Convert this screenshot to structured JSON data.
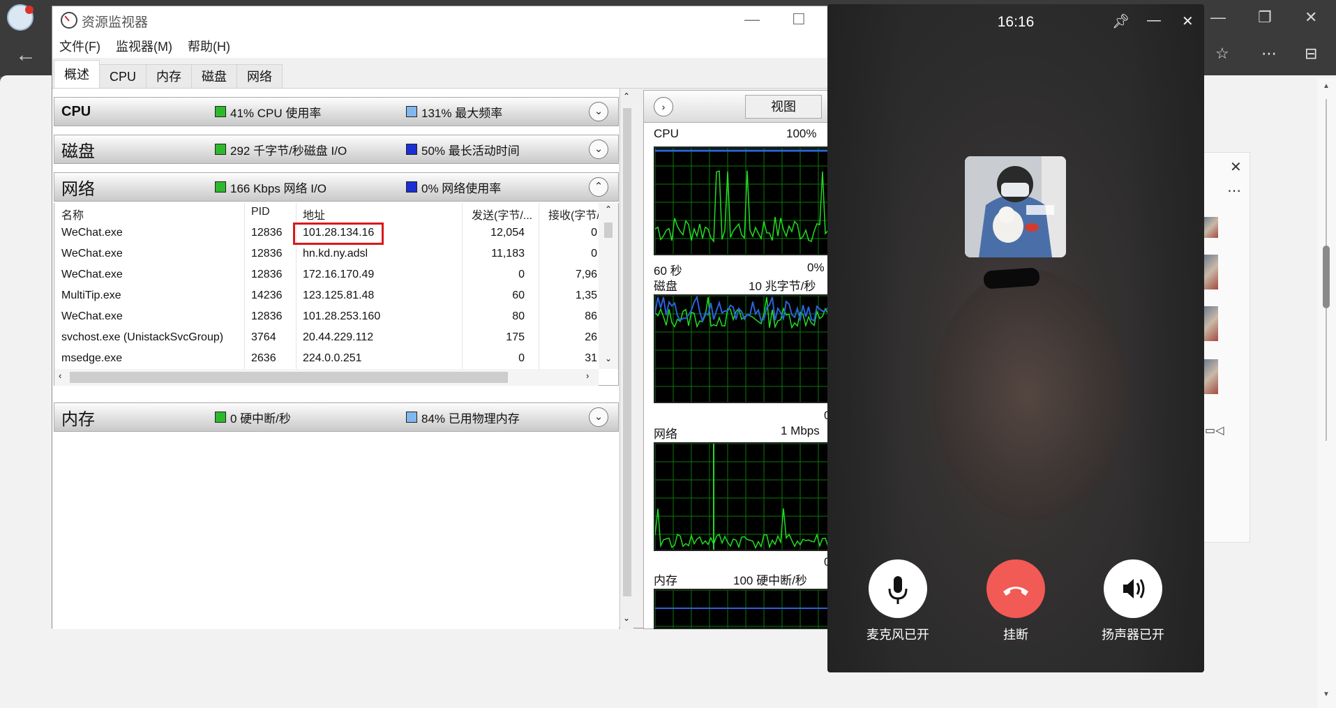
{
  "resmon": {
    "title": "资源监视器",
    "menu": [
      "文件(F)",
      "监视器(M)",
      "帮助(H)"
    ],
    "tabs": [
      "概述",
      "CPU",
      "内存",
      "磁盘",
      "网络"
    ],
    "sections": {
      "cpu": {
        "name": "CPU",
        "metric1": "41% CPU 使用率",
        "metric2": "131% 最大频率"
      },
      "disk": {
        "name": "磁盘",
        "metric1": "292 千字节/秒磁盘 I/O",
        "metric2": "50% 最长活动时间"
      },
      "network": {
        "name": "网络",
        "metric1": "166 Kbps 网络 I/O",
        "metric2": "0% 网络使用率"
      },
      "memory": {
        "name": "内存",
        "metric1": "0 硬中断/秒",
        "metric2": "84% 已用物理内存"
      }
    },
    "network_table": {
      "headers": [
        "名称",
        "PID",
        "地址",
        "发送(字节/...",
        "接收(字节/..."
      ],
      "rows": [
        {
          "name": "WeChat.exe",
          "pid": "12836",
          "addr": "101.28.134.16",
          "sent": "12,054",
          "recv": "0"
        },
        {
          "name": "WeChat.exe",
          "pid": "12836",
          "addr": "hn.kd.ny.adsl",
          "sent": "11,183",
          "recv": "0"
        },
        {
          "name": "WeChat.exe",
          "pid": "12836",
          "addr": "172.16.170.49",
          "sent": "0",
          "recv": "7,96"
        },
        {
          "name": "MultiTip.exe",
          "pid": "14236",
          "addr": "123.125.81.48",
          "sent": "60",
          "recv": "1,35"
        },
        {
          "name": "WeChat.exe",
          "pid": "12836",
          "addr": "101.28.253.160",
          "sent": "80",
          "recv": "86"
        },
        {
          "name": "svchost.exe (UnistackSvcGroup)",
          "pid": "3764",
          "addr": "20.44.229.112",
          "sent": "175",
          "recv": "26"
        },
        {
          "name": "msedge.exe",
          "pid": "2636",
          "addr": "224.0.0.251",
          "sent": "0",
          "recv": "31"
        }
      ]
    },
    "graphs": {
      "view_label": "视图",
      "cpu": {
        "label": "CPU",
        "max": "100%",
        "time": "60 秒",
        "min": "0%"
      },
      "disk": {
        "label": "磁盘",
        "max": "10 兆字节/秒",
        "min": "0"
      },
      "network": {
        "label": "网络",
        "max": "1 Mbps",
        "min": "0"
      },
      "memory": {
        "label": "内存",
        "max": "100 硬中断/秒"
      }
    }
  },
  "call": {
    "time": "16:16",
    "buttons": {
      "mic": "麦克风已开",
      "hangup": "挂断",
      "speaker": "扬声器已开"
    }
  },
  "colors": {
    "highlight": "#d7191b",
    "hangup": "#f25a55",
    "graph_line": "#22dd22",
    "graph_blue": "#2b63d9"
  }
}
